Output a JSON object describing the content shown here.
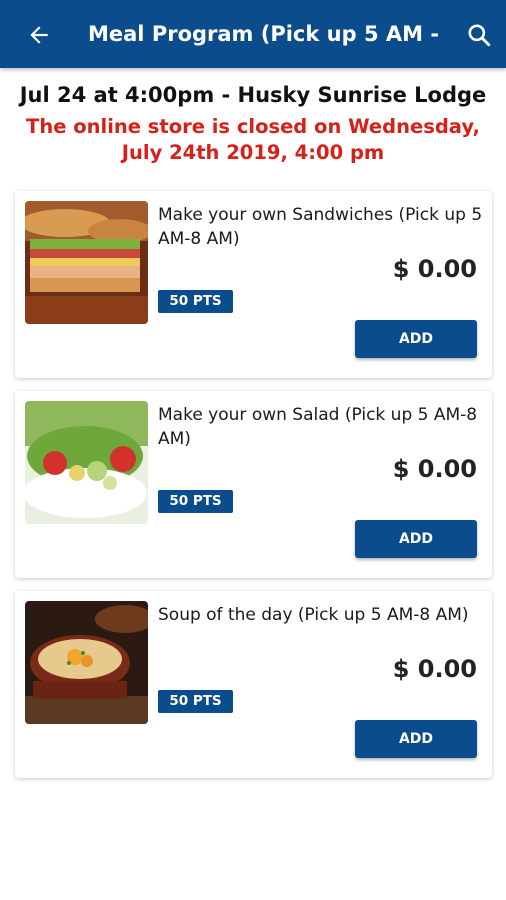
{
  "appbar": {
    "title": "Meal Program (Pick up 5 AM - ...",
    "color": "#0b4c8c",
    "back_icon": "arrow-left-icon",
    "search_icon": "search-icon"
  },
  "event": {
    "line": "Jul 24 at 4:00pm - Husky Sunrise Lodge",
    "closed_message": "The online store is closed on Wednesday, July 24th 2019, 4:00 pm",
    "closed_color": "#d6201a"
  },
  "items": [
    {
      "name": "Make your own Sandwiches (Pick up 5 AM-8 AM)",
      "price": "$ 0.00",
      "points": "50 PTS",
      "add_label": "ADD",
      "image": "sandwich-photo"
    },
    {
      "name": "Make your own Salad (Pick up 5 AM-8 AM)",
      "price": "$ 0.00",
      "points": "50 PTS",
      "add_label": "ADD",
      "image": "salad-photo"
    },
    {
      "name": "Soup of the day (Pick up 5 AM-8 AM)",
      "price": "$ 0.00",
      "points": "50 PTS",
      "add_label": "ADD",
      "image": "soup-photo"
    }
  ]
}
